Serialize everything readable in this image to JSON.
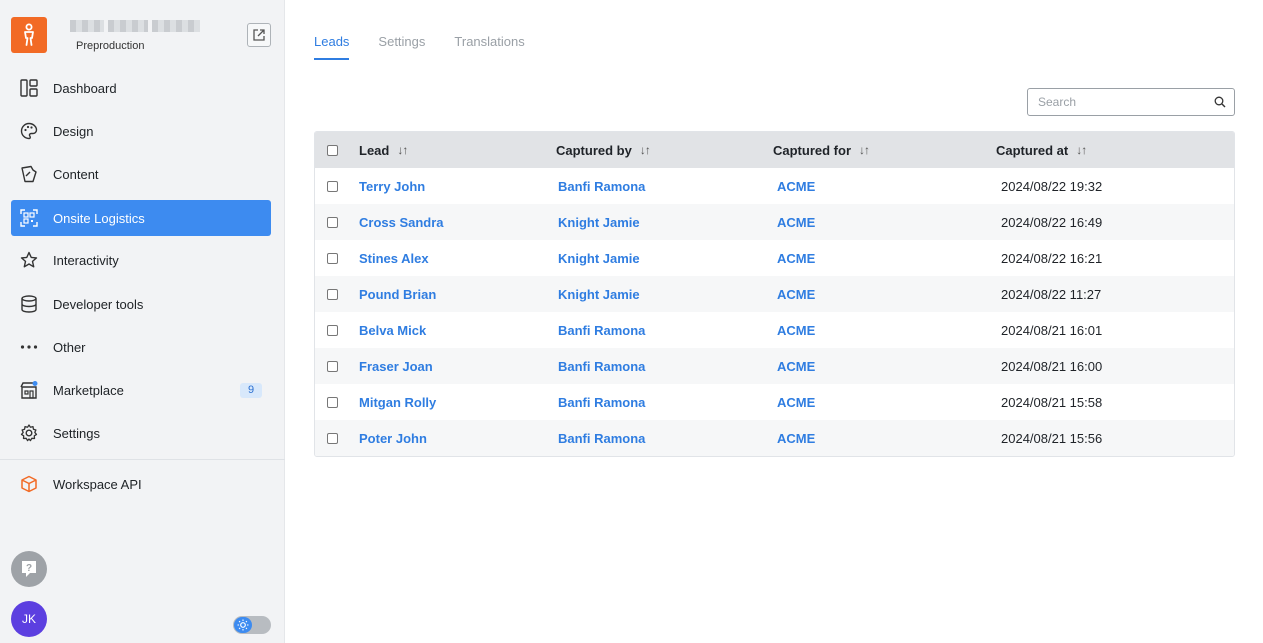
{
  "workspace": {
    "subtitle": "Preproduction"
  },
  "sidebar": {
    "items": [
      {
        "label": "Dashboard",
        "icon": "dashboard-icon"
      },
      {
        "label": "Design",
        "icon": "palette-icon"
      },
      {
        "label": "Content",
        "icon": "content-icon"
      },
      {
        "label": "Onsite Logistics",
        "icon": "qr-scan-icon",
        "active": true
      },
      {
        "label": "Interactivity",
        "icon": "star-icon"
      },
      {
        "label": "Developer tools",
        "icon": "database-icon"
      },
      {
        "label": "Other",
        "icon": "more-dots-icon"
      },
      {
        "label": "Marketplace",
        "icon": "store-icon",
        "badge": "9"
      },
      {
        "label": "Settings",
        "icon": "gear-icon"
      }
    ],
    "api_item": {
      "label": "Workspace API",
      "icon": "cube-icon"
    },
    "user_initials": "JK"
  },
  "colors": {
    "accent": "#3d8bf0",
    "brand": "#f26a25",
    "link": "#2f7de1"
  },
  "tabs": [
    "Leads",
    "Settings",
    "Translations"
  ],
  "active_tab": "Leads",
  "search": {
    "placeholder": "Search"
  },
  "table": {
    "columns": [
      "Lead",
      "Captured by",
      "Captured for",
      "Captured at"
    ],
    "rows": [
      {
        "lead": "Terry John",
        "by": "Banfi Ramona",
        "for": "ACME",
        "at": "2024/08/22 19:32"
      },
      {
        "lead": "Cross Sandra",
        "by": "Knight Jamie",
        "for": "ACME",
        "at": "2024/08/22 16:49"
      },
      {
        "lead": "Stines Alex",
        "by": "Knight Jamie",
        "for": "ACME",
        "at": "2024/08/22 16:21"
      },
      {
        "lead": "Pound Brian",
        "by": "Knight Jamie",
        "for": "ACME",
        "at": "2024/08/22 11:27"
      },
      {
        "lead": "Belva Mick",
        "by": "Banfi Ramona",
        "for": "ACME",
        "at": "2024/08/21 16:01"
      },
      {
        "lead": "Fraser Joan",
        "by": "Banfi Ramona",
        "for": "ACME",
        "at": "2024/08/21 16:00"
      },
      {
        "lead": "Mitgan Rolly",
        "by": "Banfi Ramona",
        "for": "ACME",
        "at": "2024/08/21 15:58"
      },
      {
        "lead": "Poter John",
        "by": "Banfi Ramona",
        "for": "ACME",
        "at": "2024/08/21 15:56"
      }
    ]
  }
}
